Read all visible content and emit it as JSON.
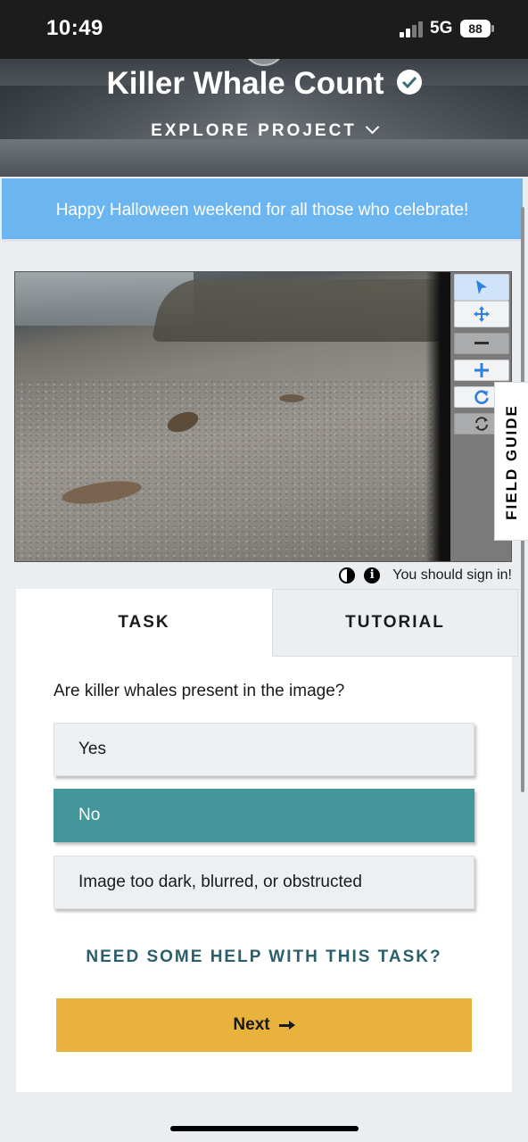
{
  "status_bar": {
    "time": "10:49",
    "network": "5G",
    "battery": "88"
  },
  "header": {
    "title": "Killer Whale Count",
    "explore_label": "EXPLORE PROJECT"
  },
  "announcement": {
    "text": "Happy Halloween weekend for all those who celebrate!"
  },
  "viewer": {
    "tools": [
      {
        "name": "annotate",
        "icon": "pointer-icon"
      },
      {
        "name": "move",
        "icon": "move-icon"
      },
      {
        "name": "zoom-out",
        "icon": "minus-icon"
      },
      {
        "name": "zoom-in",
        "icon": "plus-icon"
      },
      {
        "name": "rotate",
        "icon": "rotate-icon"
      },
      {
        "name": "reset",
        "icon": "reset-icon"
      }
    ],
    "field_guide_label": "FIELD GUIDE",
    "sign_in_text": "You should sign in!"
  },
  "task_panel": {
    "tabs": [
      {
        "label": "TASK"
      },
      {
        "label": "TUTORIAL"
      }
    ],
    "question": "Are killer whales present in the image?",
    "answers": [
      {
        "label": "Yes",
        "selected": false
      },
      {
        "label": "No",
        "selected": true
      },
      {
        "label": "Image too dark, blurred, or obstructed",
        "selected": false
      }
    ],
    "help_link": "NEED SOME HELP WITH THIS TASK?",
    "next_label": "Next"
  },
  "colors": {
    "accent_teal": "#43969a",
    "next_yellow": "#e8b23c",
    "announcement_blue": "#6bb6f1",
    "link_teal": "#2b5f6c"
  }
}
